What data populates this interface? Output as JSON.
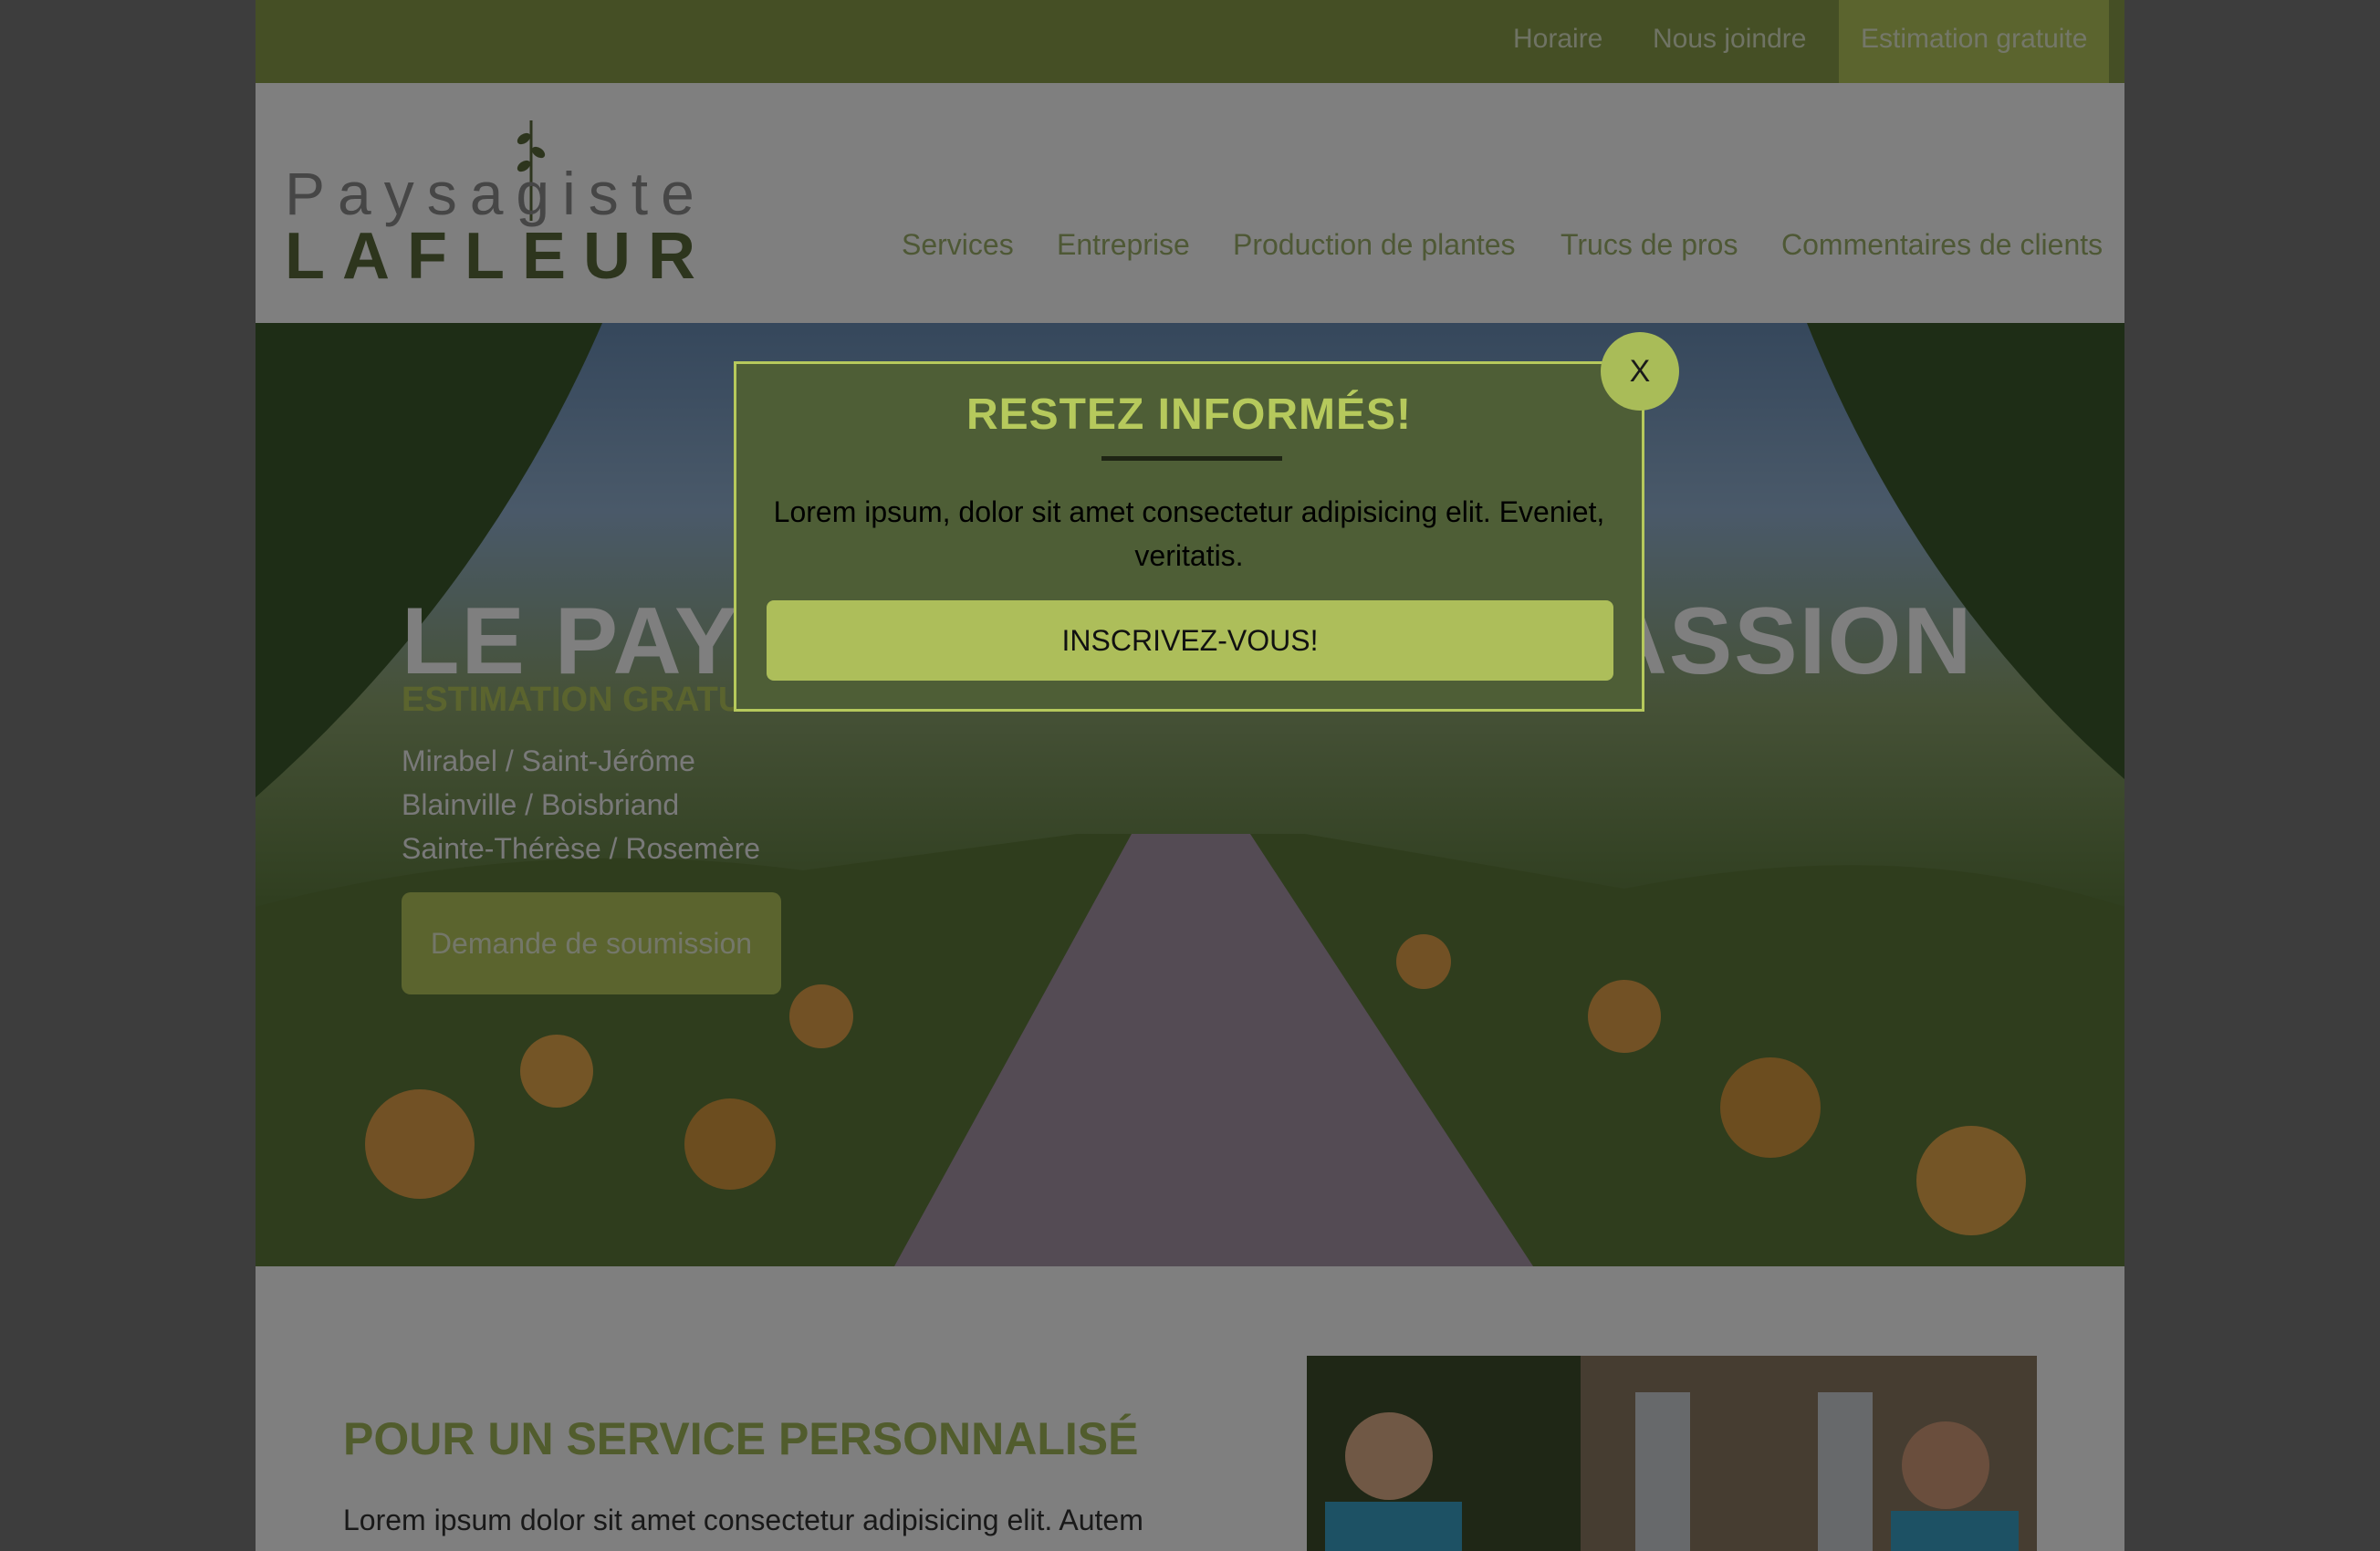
{
  "topbar": {
    "links": [
      "Horaire",
      "Nous joindre"
    ],
    "cta": "Estimation gratuite"
  },
  "logo": {
    "line1": "Paysagiste",
    "line2": "LAFLEUR"
  },
  "nav": [
    "Services",
    "Entreprise",
    "Production de plantes",
    "Trucs de pros",
    "Commentaires de clients"
  ],
  "hero": {
    "title_left": "LE PAYS",
    "title_right": "ASSION",
    "subtitle": "ESTIMATION GRATUITE",
    "areas": [
      "Mirabel / Saint-Jérôme",
      "Blainville / Boisbriand",
      "Sainte-Thérèse / Rosemère"
    ],
    "button": "Demande de soumission"
  },
  "section": {
    "title": "POUR UN SERVICE PERSONNALISÉ",
    "text": "Lorem ipsum dolor sit amet consectetur adipisicing elit. Autem"
  },
  "modal": {
    "title": "RESTEZ INFORMÉS!",
    "text": "Lorem ipsum, dolor sit amet consectetur adipisicing elit. Eveniet, veritatis.",
    "button": "INSCRIVEZ-VOUS!",
    "close": "X"
  },
  "colors": {
    "brand_green": "#b6c95c",
    "dark_green": "#5b6a3b",
    "modal_bg": "#4e5e36"
  }
}
